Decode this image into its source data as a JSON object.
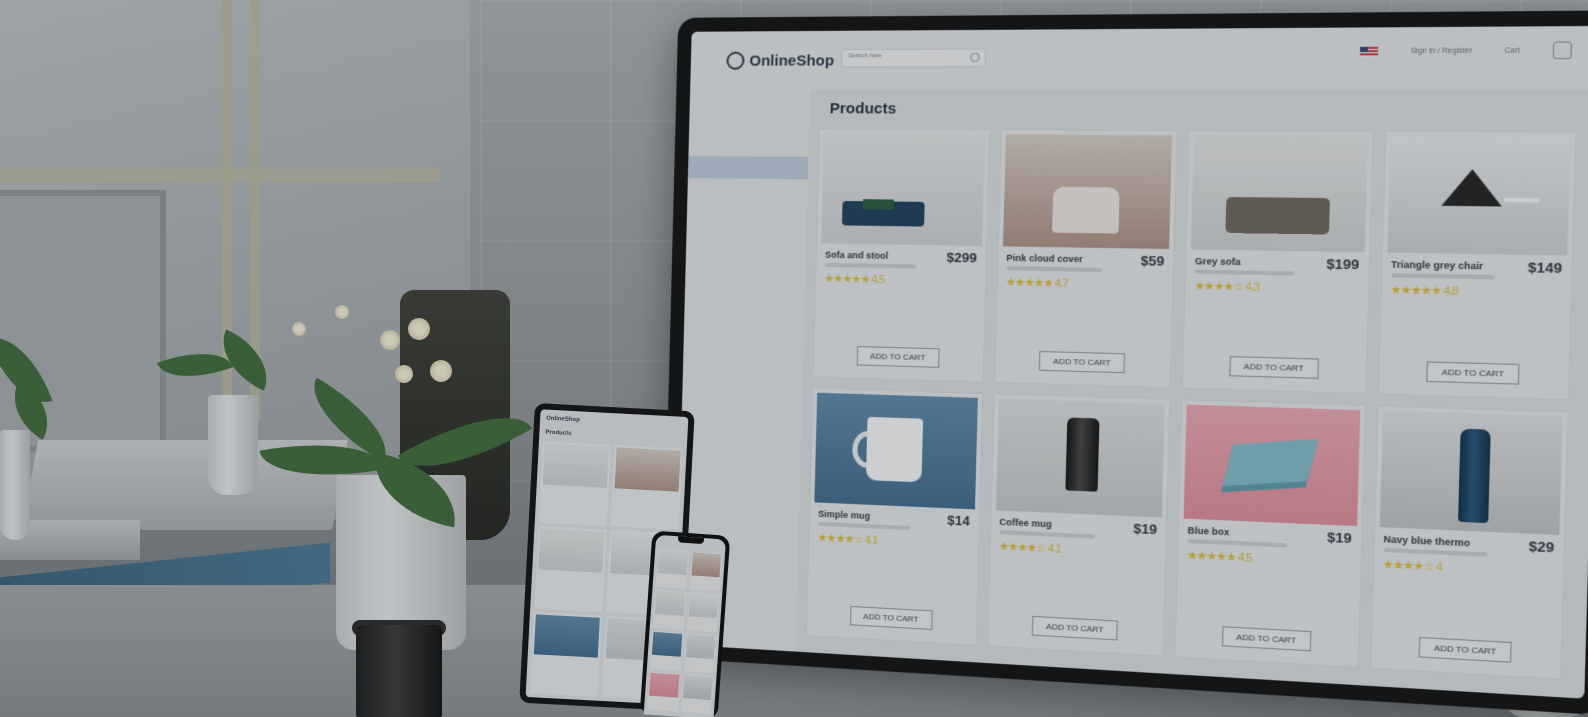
{
  "desktop_site": {
    "logo": "OnlineShop",
    "search_placeholder": "Search here",
    "header_links": [
      "Sign in / Register",
      "Cart"
    ],
    "page_title": "Products",
    "sidebar_items": [
      "",
      "",
      "",
      "",
      "",
      "",
      "",
      ""
    ],
    "active_sidebar_index": 3,
    "products": [
      {
        "name": "Sofa and stool",
        "price": "$299",
        "rating": 4.5,
        "button": "ADD TO CART",
        "scene": "scene-sofa-blue"
      },
      {
        "name": "Pink cloud cover",
        "price": "$59",
        "rating": 4.7,
        "button": "ADD TO CART",
        "scene": "scene-fluffy"
      },
      {
        "name": "Grey sofa",
        "price": "$199",
        "rating": 4.3,
        "button": "ADD TO CART",
        "scene": "scene-grey"
      },
      {
        "name": "Triangle grey chair",
        "price": "$149",
        "rating": 4.8,
        "button": "ADD TO CART",
        "scene": "scene-triangle"
      },
      {
        "name": "Simple mug",
        "price": "$14",
        "rating": 4.1,
        "button": "ADD TO CART",
        "scene": "scene-mug"
      },
      {
        "name": "Coffee mug",
        "price": "$19",
        "rating": 4.1,
        "button": "ADD TO CART",
        "scene": "scene-coffee"
      },
      {
        "name": "Blue box",
        "price": "$19",
        "rating": 4.5,
        "button": "ADD TO CART",
        "scene": "scene-box"
      },
      {
        "name": "Navy blue thermo",
        "price": "$29",
        "rating": 4.0,
        "button": "ADD TO CART",
        "scene": "scene-thermo"
      }
    ]
  },
  "tablet_site": {
    "logo": "OnlineShop",
    "page_title": "Products"
  },
  "colors": {
    "star": "#d8b93c",
    "text_dark": "#2c3742",
    "screen_bg": "#d4d8da"
  }
}
